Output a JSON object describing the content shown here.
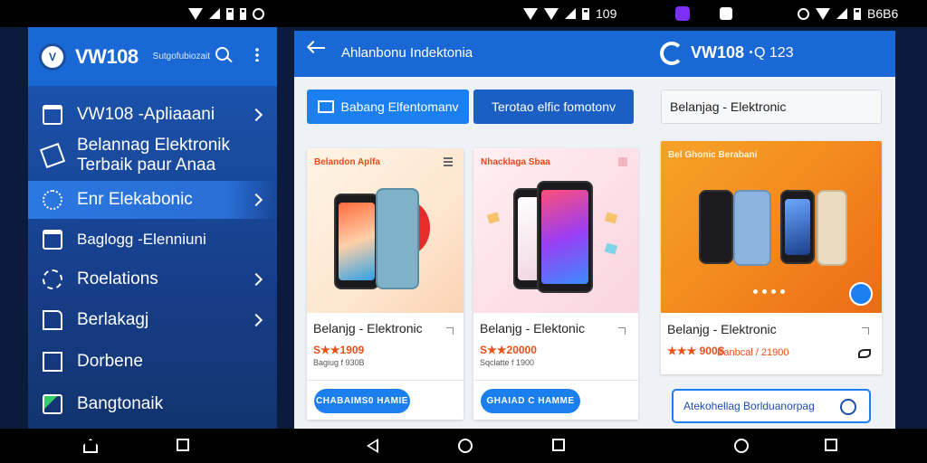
{
  "status_bar": {
    "left_glyph": "@",
    "right_time_1": "109",
    "right_time_2": "B6B6"
  },
  "sidebar": {
    "brand": "VW108",
    "brand_sub": "Sutgofubiozait",
    "items": [
      {
        "label": "VW108 -Apliaaani",
        "icon": "bag-icon"
      },
      {
        "label": "Belannag Elektronik Terbaik paur Anaa",
        "icon": "paper-plane-icon"
      },
      {
        "label": "Enr Elekabonic",
        "icon": "target-icon"
      },
      {
        "label": "Baglogg -Elenniuni",
        "icon": "bag-icon"
      },
      {
        "label": "Roelations",
        "icon": "gear-icon"
      },
      {
        "label": "Berlakagj",
        "icon": "document-icon"
      },
      {
        "label": "Dorbene",
        "icon": "square-icon"
      },
      {
        "label": "Bangtonaik",
        "icon": "image-icon"
      }
    ]
  },
  "main": {
    "top_title": "Ahlanbonu Indektonia",
    "top_brand": "VW108 ·",
    "top_right": "Q 123",
    "btn_a": "Babang Elfentomanv",
    "btn_b": "Terotao elfic fomotonv",
    "search_value": "Belanjag - Elektronic",
    "cards": [
      {
        "img_label": "Belandon Aplfa",
        "title": "Belanjg - Elektronic",
        "price": "S★★1909",
        "subprice": "Bagiug f 930B",
        "button": "CHABAIMS0 HAMIE"
      },
      {
        "img_label": "Nhacklaga Sbaa",
        "title": "Belanjg - Elektonic",
        "price": "S★★20000",
        "subprice": "Sqclatte f 1900",
        "button": "GHAIAD C HAMME"
      }
    ],
    "promo": {
      "img_label": "Bel Ghonic Berabani",
      "title": "Belanjg - Elektronic",
      "price": "★★★ 900S",
      "subprice": "Banbcal / 21900",
      "bottom_search": "Atekohellag Borlduanorpag"
    }
  },
  "colors": {
    "primary": "#1b7ff0",
    "header_blue": "#1a68d6",
    "sidebar_dark": "#173f8c",
    "price_orange": "#e8501a"
  }
}
